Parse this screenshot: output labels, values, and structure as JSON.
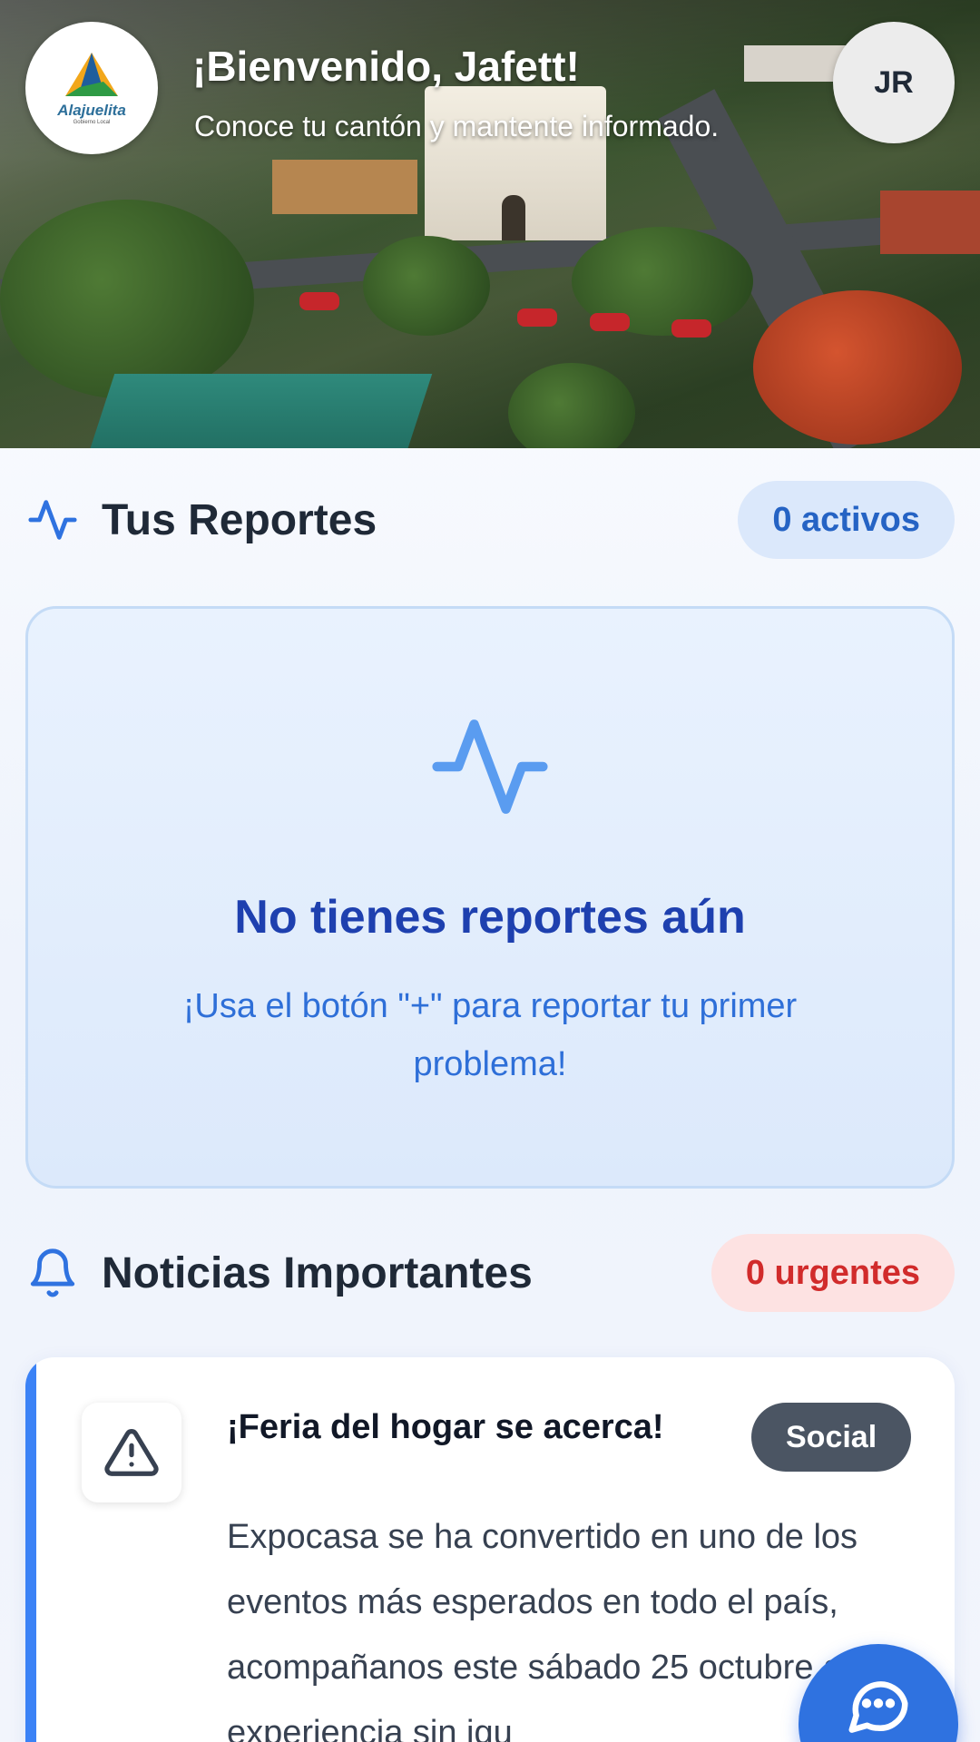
{
  "header": {
    "logo_name": "Alajuelita",
    "logo_sub": "Gobierno Local",
    "welcome": "¡Bienvenido, Jafett!",
    "tagline": "Conoce tu cantón y mantente informado.",
    "avatar_initials": "JR"
  },
  "reports": {
    "title": "Tus Reportes",
    "badge": "0 activos",
    "empty_title": "No tienes reportes aún",
    "empty_text": "¡Usa el botón \"+\" para reportar tu primer problema!"
  },
  "news": {
    "title": "Noticias Importantes",
    "badge": "0 urgentes",
    "items": [
      {
        "title": "¡Feria del hogar se acerca!",
        "tag": "Social",
        "body": "Expocasa se ha convertido en uno de los eventos más esperados en todo el país, acompañanos este sábado 25 octubre a una experiencia sin igu"
      }
    ]
  },
  "icons": {
    "reports": "activity-icon",
    "news": "bell-icon",
    "news_item": "warning-icon",
    "fab": "chat-icon"
  },
  "colors": {
    "primary": "#2f72e0",
    "accent_blue": "#3b82f6",
    "urgent_red": "#d12b2b",
    "title_dark": "#1f2937"
  }
}
